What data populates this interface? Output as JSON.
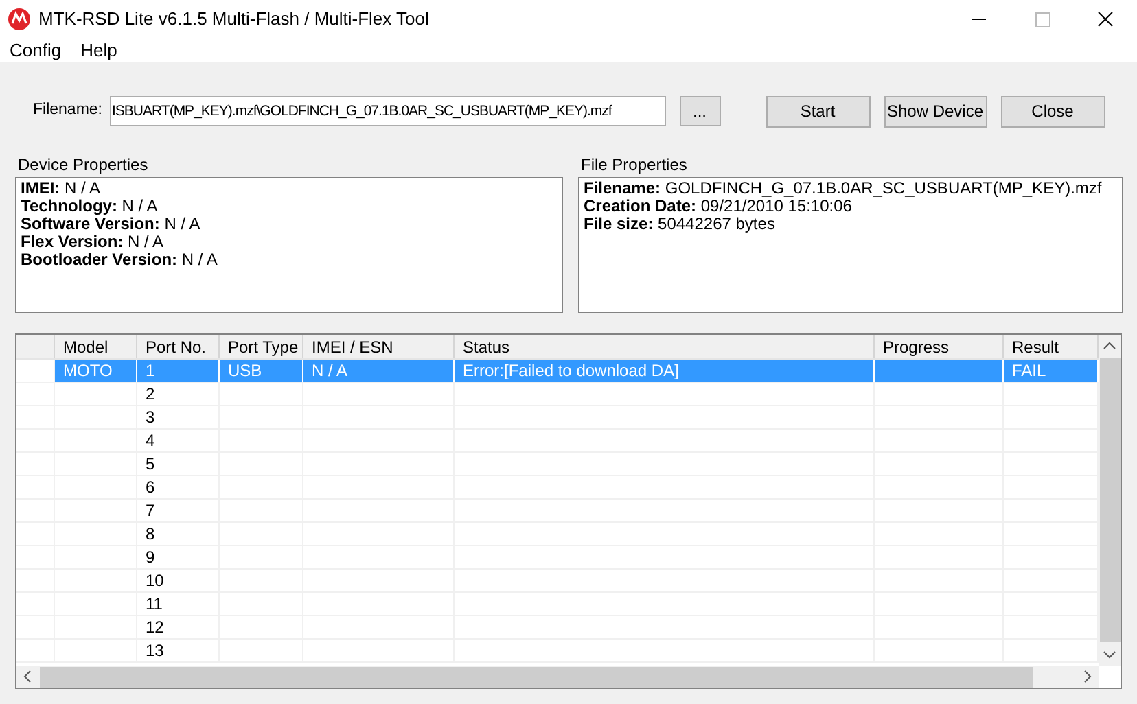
{
  "window": {
    "title": "MTK-RSD Lite v6.1.5 Multi-Flash / Multi-Flex Tool"
  },
  "menu": [
    "Config",
    "Help"
  ],
  "filename": {
    "label": "Filename:",
    "value": "ISBUART(MP_KEY).mzf\\GOLDFINCH_G_07.1B.0AR_SC_USBUART(MP_KEY).mzf",
    "browse": "..."
  },
  "buttons": [
    "Start",
    "Show Device",
    "Close"
  ],
  "device_properties": {
    "title": "Device Properties",
    "lines": [
      {
        "label": "IMEI:",
        "value": "N / A"
      },
      {
        "label": "Technology:",
        "value": "N / A"
      },
      {
        "label": "Software Version:",
        "value": "N / A"
      },
      {
        "label": "Flex Version:",
        "value": "N / A"
      },
      {
        "label": "Bootloader Version:",
        "value": "N / A"
      }
    ]
  },
  "file_properties": {
    "title": "File Properties",
    "lines": [
      {
        "label": "Filename:",
        "value": "GOLDFINCH_G_07.1B.0AR_SC_USBUART(MP_KEY).mzf"
      },
      {
        "label": "Creation Date:",
        "value": "09/21/2010 15:10:06"
      },
      {
        "label": "File size:",
        "value": "50442267 bytes"
      }
    ]
  },
  "table": {
    "columns": [
      "Model",
      "Port No.",
      "Port Type",
      "IMEI / ESN",
      "Status",
      "Progress",
      "Result"
    ],
    "rows": [
      {
        "selected": true,
        "cells": [
          "MOTO",
          "1",
          "USB",
          "N / A",
          "Error:[Failed to download DA]",
          null,
          "FAIL"
        ]
      },
      {
        "selected": false,
        "cells": [
          null,
          "2"
        ]
      },
      {
        "selected": false,
        "cells": [
          null,
          "3"
        ]
      },
      {
        "selected": false,
        "cells": [
          null,
          "4"
        ]
      },
      {
        "selected": false,
        "cells": [
          null,
          "5"
        ]
      },
      {
        "selected": false,
        "cells": [
          null,
          "6"
        ]
      },
      {
        "selected": false,
        "cells": [
          null,
          "7"
        ]
      },
      {
        "selected": false,
        "cells": [
          null,
          "8"
        ]
      },
      {
        "selected": false,
        "cells": [
          null,
          "9"
        ]
      },
      {
        "selected": false,
        "cells": [
          null,
          "10"
        ]
      },
      {
        "selected": false,
        "cells": [
          null,
          "11"
        ]
      },
      {
        "selected": false,
        "cells": [
          null,
          "12"
        ]
      },
      {
        "selected": false,
        "cells": [
          null,
          "13"
        ]
      }
    ]
  }
}
